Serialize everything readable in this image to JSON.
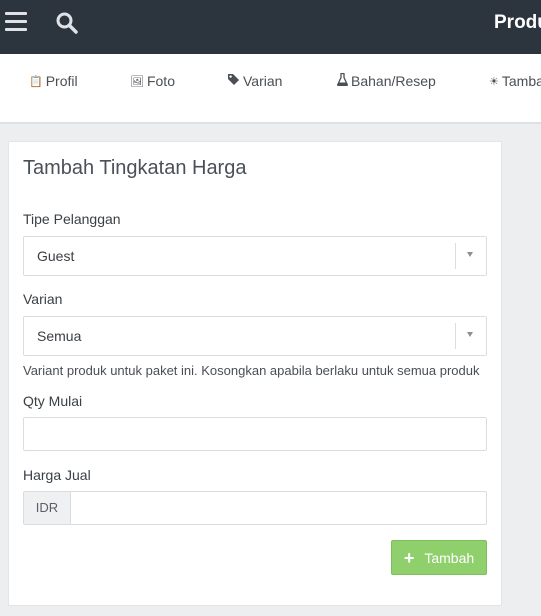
{
  "header": {
    "title": "Produ",
    "menu_icon": "hamburger-icon",
    "search_icon": "search-icon"
  },
  "tabs": [
    {
      "label": "Profil",
      "icon": "clipboard-icon"
    },
    {
      "label": "Foto",
      "icon": "image-icon"
    },
    {
      "label": "Varian",
      "icon": "tag-icon"
    },
    {
      "label": "Bahan/Resep",
      "icon": "flask-icon"
    },
    {
      "label": "Tamba",
      "icon": "sun-icon"
    }
  ],
  "form": {
    "title": "Tambah Tingkatan Harga",
    "customer_type": {
      "label": "Tipe Pelanggan",
      "value": "Guest"
    },
    "variant": {
      "label": "Varian",
      "value": "Semua",
      "help": "Variant produk untuk paket ini. Kosongkan apabila berlaku untuk semua produk"
    },
    "qty_start": {
      "label": "Qty Mulai",
      "value": ""
    },
    "price": {
      "label": "Harga Jual",
      "currency": "IDR",
      "value": ""
    },
    "submit_label": "Tambah"
  },
  "colors": {
    "topbar": "#2c343e",
    "button": "#8fd06c"
  }
}
